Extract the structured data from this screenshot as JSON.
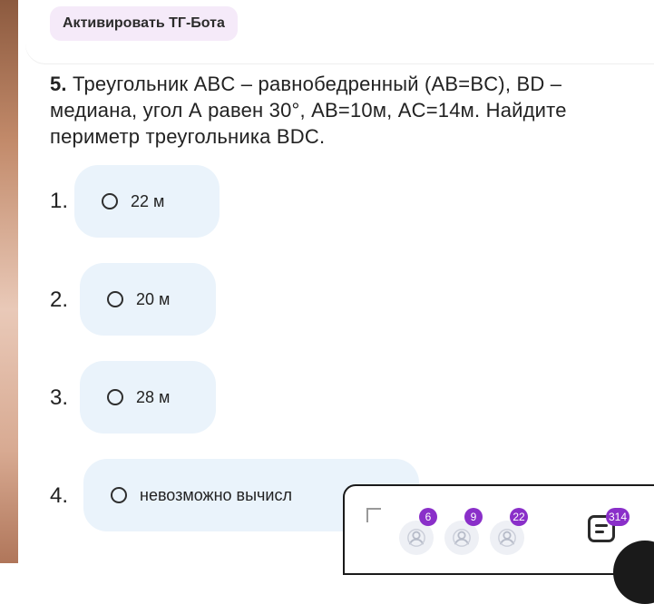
{
  "header": {
    "tg_button_label": "Активировать ТГ-Бота"
  },
  "question": {
    "number": "5.",
    "text": " Треугольник ABC – равнобедренный (AB=BC), BD –медиана, угол А равен 30°, AB=10м, AC=14м.  Найдите периметр треугольника BDC."
  },
  "options": [
    {
      "number": "1.",
      "label": "22 м"
    },
    {
      "number": "2.",
      "label": "20 м"
    },
    {
      "number": "3.",
      "label": "28 м"
    },
    {
      "number": "4.",
      "label": "невозможно вычисл"
    }
  ],
  "overlay": {
    "badges": [
      "6",
      "9",
      "22"
    ],
    "notes_badge": "314"
  },
  "colors": {
    "accent": "#8a2fc9",
    "option_bg": "#eaf3fb",
    "tg_button_bg": "#f5eaf9"
  }
}
